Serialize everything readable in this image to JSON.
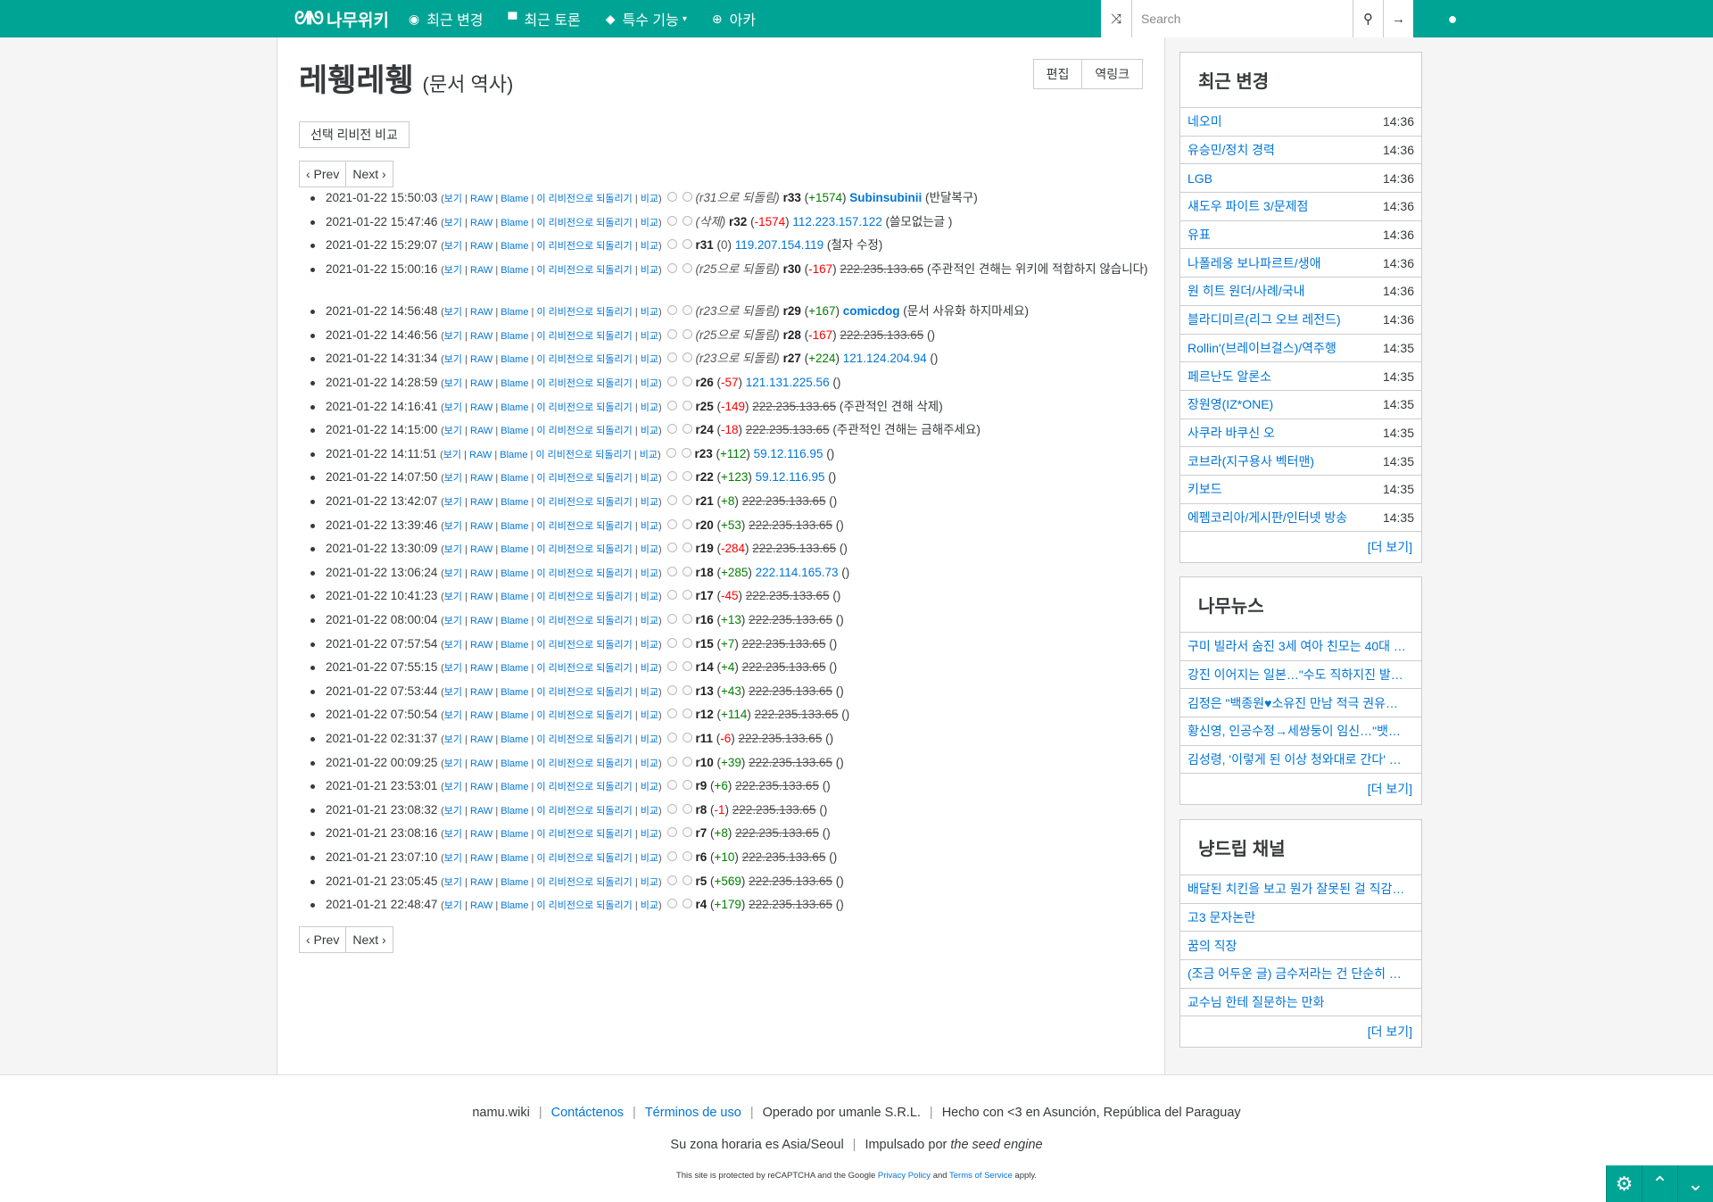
{
  "nav": {
    "logo": "나무위키",
    "items": [
      {
        "icon": "compass-icon",
        "glyph": "◉",
        "label": "최근 변경"
      },
      {
        "icon": "comment-icon",
        "glyph": "▀",
        "label": "최근 토론"
      },
      {
        "icon": "cube-icon",
        "glyph": "◆",
        "label": "특수 기능",
        "caret": "▾"
      },
      {
        "icon": "arca-icon",
        "glyph": "⊕",
        "label": "아카"
      }
    ],
    "search_placeholder": "Search",
    "random_glyph": "⤨",
    "search_glyph": "⚲",
    "go_glyph": "→",
    "user_glyph": "👤"
  },
  "page": {
    "title": "레휑레휑",
    "subtitle": "(문서 역사)",
    "edit_label": "편집",
    "backlink_label": "역링크",
    "compare_label": "선택 리비전 비교",
    "prev_label": "‹ Prev",
    "next_label": "Next ›"
  },
  "tools": {
    "view": "보기",
    "raw": "RAW",
    "blame": "Blame",
    "revert": "이 리비전으로 되돌리기",
    "diff": "비교"
  },
  "revisions": [
    {
      "date": "2021-01-22 15:50:03",
      "note": "(r31으로 되돌림)",
      "rev": "r33",
      "delta": "+1574",
      "sign": "pos",
      "user": "Subinsubinii",
      "utype": "reg",
      "comment": "(반달복구)"
    },
    {
      "date": "2021-01-22 15:47:46",
      "note": "(삭제)",
      "rev": "r32",
      "delta": "-1574",
      "sign": "neg",
      "user": "112.223.157.122",
      "utype": "ip",
      "comment": "(쓸모없는글 )"
    },
    {
      "date": "2021-01-22 15:29:07",
      "note": "",
      "rev": "r31",
      "delta": "0",
      "sign": "zero",
      "user": "119.207.154.119",
      "utype": "ip",
      "comment": "(철자 수정)"
    },
    {
      "date": "2021-01-22 15:00:16",
      "note": "(r25으로 되돌림)",
      "rev": "r30",
      "delta": "-167",
      "sign": "neg",
      "user": "222.235.133.65",
      "utype": "blk",
      "comment": "(주관적인 견해는 위키에 적합하지 않습니다)",
      "two": true
    },
    {
      "date": "2021-01-22 14:56:48",
      "note": "(r23으로 되돌림)",
      "rev": "r29",
      "delta": "+167",
      "sign": "pos",
      "user": "comicdog",
      "utype": "reg",
      "comment": "(문서 사유화 하지마세요)"
    },
    {
      "date": "2021-01-22 14:46:56",
      "note": "(r25으로 되돌림)",
      "rev": "r28",
      "delta": "-167",
      "sign": "neg",
      "user": "222.235.133.65",
      "utype": "blk",
      "comment": "()"
    },
    {
      "date": "2021-01-22 14:31:34",
      "note": "(r23으로 되돌림)",
      "rev": "r27",
      "delta": "+224",
      "sign": "pos",
      "user": "121.124.204.94",
      "utype": "ip",
      "comment": "()"
    },
    {
      "date": "2021-01-22 14:28:59",
      "note": "",
      "rev": "r26",
      "delta": "-57",
      "sign": "neg",
      "user": "121.131.225.56",
      "utype": "ip",
      "comment": "()"
    },
    {
      "date": "2021-01-22 14:16:41",
      "note": "",
      "rev": "r25",
      "delta": "-149",
      "sign": "neg",
      "user": "222.235.133.65",
      "utype": "blk",
      "comment": "(주관적인 견해 삭제)"
    },
    {
      "date": "2021-01-22 14:15:00",
      "note": "",
      "rev": "r24",
      "delta": "-18",
      "sign": "neg",
      "user": "222.235.133.65",
      "utype": "blk",
      "comment": "(주관적인 견해는 금해주세요)"
    },
    {
      "date": "2021-01-22 14:11:51",
      "note": "",
      "rev": "r23",
      "delta": "+112",
      "sign": "pos",
      "user": "59.12.116.95",
      "utype": "ip",
      "comment": "()"
    },
    {
      "date": "2021-01-22 14:07:50",
      "note": "",
      "rev": "r22",
      "delta": "+123",
      "sign": "pos",
      "user": "59.12.116.95",
      "utype": "ip",
      "comment": "()"
    },
    {
      "date": "2021-01-22 13:42:07",
      "note": "",
      "rev": "r21",
      "delta": "+8",
      "sign": "pos",
      "user": "222.235.133.65",
      "utype": "blk",
      "comment": "()"
    },
    {
      "date": "2021-01-22 13:39:46",
      "note": "",
      "rev": "r20",
      "delta": "+53",
      "sign": "pos",
      "user": "222.235.133.65",
      "utype": "blk",
      "comment": "()"
    },
    {
      "date": "2021-01-22 13:30:09",
      "note": "",
      "rev": "r19",
      "delta": "-284",
      "sign": "neg",
      "user": "222.235.133.65",
      "utype": "blk",
      "comment": "()"
    },
    {
      "date": "2021-01-22 13:06:24",
      "note": "",
      "rev": "r18",
      "delta": "+285",
      "sign": "pos",
      "user": "222.114.165.73",
      "utype": "ip",
      "comment": "()"
    },
    {
      "date": "2021-01-22 10:41:23",
      "note": "",
      "rev": "r17",
      "delta": "-45",
      "sign": "neg",
      "user": "222.235.133.65",
      "utype": "blk",
      "comment": "()"
    },
    {
      "date": "2021-01-22 08:00:04",
      "note": "",
      "rev": "r16",
      "delta": "+13",
      "sign": "pos",
      "user": "222.235.133.65",
      "utype": "blk",
      "comment": "()"
    },
    {
      "date": "2021-01-22 07:57:54",
      "note": "",
      "rev": "r15",
      "delta": "+7",
      "sign": "pos",
      "user": "222.235.133.65",
      "utype": "blk",
      "comment": "()"
    },
    {
      "date": "2021-01-22 07:55:15",
      "note": "",
      "rev": "r14",
      "delta": "+4",
      "sign": "pos",
      "user": "222.235.133.65",
      "utype": "blk",
      "comment": "()"
    },
    {
      "date": "2021-01-22 07:53:44",
      "note": "",
      "rev": "r13",
      "delta": "+43",
      "sign": "pos",
      "user": "222.235.133.65",
      "utype": "blk",
      "comment": "()"
    },
    {
      "date": "2021-01-22 07:50:54",
      "note": "",
      "rev": "r12",
      "delta": "+114",
      "sign": "pos",
      "user": "222.235.133.65",
      "utype": "blk",
      "comment": "()"
    },
    {
      "date": "2021-01-22 02:31:37",
      "note": "",
      "rev": "r11",
      "delta": "-6",
      "sign": "neg",
      "user": "222.235.133.65",
      "utype": "blk",
      "comment": "()"
    },
    {
      "date": "2021-01-22 00:09:25",
      "note": "",
      "rev": "r10",
      "delta": "+39",
      "sign": "pos",
      "user": "222.235.133.65",
      "utype": "blk",
      "comment": "()"
    },
    {
      "date": "2021-01-21 23:53:01",
      "note": "",
      "rev": "r9",
      "delta": "+6",
      "sign": "pos",
      "user": "222.235.133.65",
      "utype": "blk",
      "comment": "()"
    },
    {
      "date": "2021-01-21 23:08:32",
      "note": "",
      "rev": "r8",
      "delta": "-1",
      "sign": "neg",
      "user": "222.235.133.65",
      "utype": "blk",
      "comment": "()"
    },
    {
      "date": "2021-01-21 23:08:16",
      "note": "",
      "rev": "r7",
      "delta": "+8",
      "sign": "pos",
      "user": "222.235.133.65",
      "utype": "blk",
      "comment": "()"
    },
    {
      "date": "2021-01-21 23:07:10",
      "note": "",
      "rev": "r6",
      "delta": "+10",
      "sign": "pos",
      "user": "222.235.133.65",
      "utype": "blk",
      "comment": "()"
    },
    {
      "date": "2021-01-21 23:05:45",
      "note": "",
      "rev": "r5",
      "delta": "+569",
      "sign": "pos",
      "user": "222.235.133.65",
      "utype": "blk",
      "comment": "()"
    },
    {
      "date": "2021-01-21 22:48:47",
      "note": "",
      "rev": "r4",
      "delta": "+179",
      "sign": "pos",
      "user": "222.235.133.65",
      "utype": "blk",
      "comment": "()"
    }
  ],
  "sidebar": {
    "recent": {
      "title": "최근 변경",
      "items": [
        {
          "label": "네오미",
          "time": "14:36"
        },
        {
          "label": "유승민/정치 경력",
          "time": "14:36"
        },
        {
          "label": "LGB",
          "time": "14:36"
        },
        {
          "label": "섀도우 파이트 3/문제점",
          "time": "14:36"
        },
        {
          "label": "유표",
          "time": "14:36"
        },
        {
          "label": "나폴레옹 보나파르트/생애",
          "time": "14:36"
        },
        {
          "label": "원 히트 원더/사례/국내",
          "time": "14:36"
        },
        {
          "label": "블라디미르(리그 오브 레전드)",
          "time": "14:36"
        },
        {
          "label": "Rollin'(브레이브걸스)/역주행",
          "time": "14:35"
        },
        {
          "label": "페르난도 알론소",
          "time": "14:35"
        },
        {
          "label": "장원영(IZ*ONE)",
          "time": "14:35"
        },
        {
          "label": "사쿠라 바쿠신 오",
          "time": "14:35"
        },
        {
          "label": "코브라(지구용사 벡터맨)",
          "time": "14:35"
        },
        {
          "label": "키보드",
          "time": "14:35"
        },
        {
          "label": "에펨코리아/게시판/인터넷 방송",
          "time": "14:35"
        }
      ],
      "more": "[더 보기]"
    },
    "news": {
      "title": "나무뉴스",
      "items": [
        {
          "label": "구미 빌라서 숨진 3세 여아 친모는 40대 …"
        },
        {
          "label": "강진 이어지는 일본…\"수도 직하지진 발생…"
        },
        {
          "label": "김정은 \"백종원♥소유진 만남 적극 권유……"
        },
        {
          "label": "황신영, 인공수정→세쌍둥이 임신…\"뱃속…"
        },
        {
          "label": "김성령, '이렇게 된 이상 청와대로 간다' 출…"
        }
      ],
      "more": "[더 보기]"
    },
    "channel": {
      "title": "냥드립 채널",
      "items": [
        {
          "label": "배달된 치킨을 보고 뭔가 잘못된 걸 직감…"
        },
        {
          "label": "고3 문자논란"
        },
        {
          "label": "꿈의 직장"
        },
        {
          "label": "(조금 어두운 글) 금수저라는 건 단순히 경…"
        },
        {
          "label": "교수님 한테 질문하는 만화"
        }
      ],
      "more": "[더 보기]"
    }
  },
  "footer": {
    "site": "namu.wiki",
    "contact": "Contáctenos",
    "terms": "Términos de uso",
    "operated": "Operado por umanle S.R.L.",
    "made": "Hecho con <3 en Asunción, República del Paraguay",
    "timezone": "Su zona horaria es Asia/Seoul",
    "powered_prefix": "Impulsado por",
    "powered_engine": "the seed engine",
    "recaptcha_prefix": "This site is protected by reCAPTCHA and the Google",
    "privacy": "Privacy Policy",
    "and": "and",
    "tos": "Terms of Service",
    "apply": "apply."
  },
  "corner": {
    "settings_glyph": "⚙",
    "up_glyph": "⌃",
    "down_glyph": "⌄"
  },
  "colors": {
    "brand": "#00a495",
    "link": "#0275d8",
    "positive": "#008000",
    "negative": "#ff0000"
  }
}
